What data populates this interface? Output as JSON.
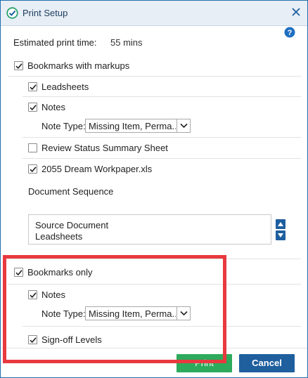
{
  "window": {
    "title": "Print Setup"
  },
  "estimate": {
    "label": "Estimated print time:",
    "value": "55 mins"
  },
  "bookmarks_with_markups": {
    "label": "Bookmarks with markups",
    "checked": true,
    "leadsheets": {
      "label": "Leadsheets",
      "checked": true
    },
    "notes": {
      "label": "Notes",
      "checked": true
    },
    "note_type": {
      "label": "Note Type:",
      "value": "Missing Item, Perma..."
    },
    "review_status": {
      "label": "Review Status Summary Sheet",
      "checked": false
    },
    "workpaper": {
      "label": "2055 Dream Workpaper.xls",
      "checked": true
    },
    "document_sequence": {
      "heading": "Document Sequence",
      "items": [
        "Source Document",
        "Leadsheets"
      ]
    }
  },
  "bookmarks_only": {
    "label": "Bookmarks only",
    "checked": true,
    "notes": {
      "label": "Notes",
      "checked": true
    },
    "note_type": {
      "label": "Note Type:",
      "value": "Missing Item, Perma..."
    },
    "signoff": {
      "label": "Sign-off Levels",
      "checked": true
    }
  },
  "buttons": {
    "print": "Print",
    "cancel": "Cancel"
  },
  "colors": {
    "accent": "#1f5f9e",
    "print": "#2eaa5c",
    "highlight": "#e8393f"
  }
}
